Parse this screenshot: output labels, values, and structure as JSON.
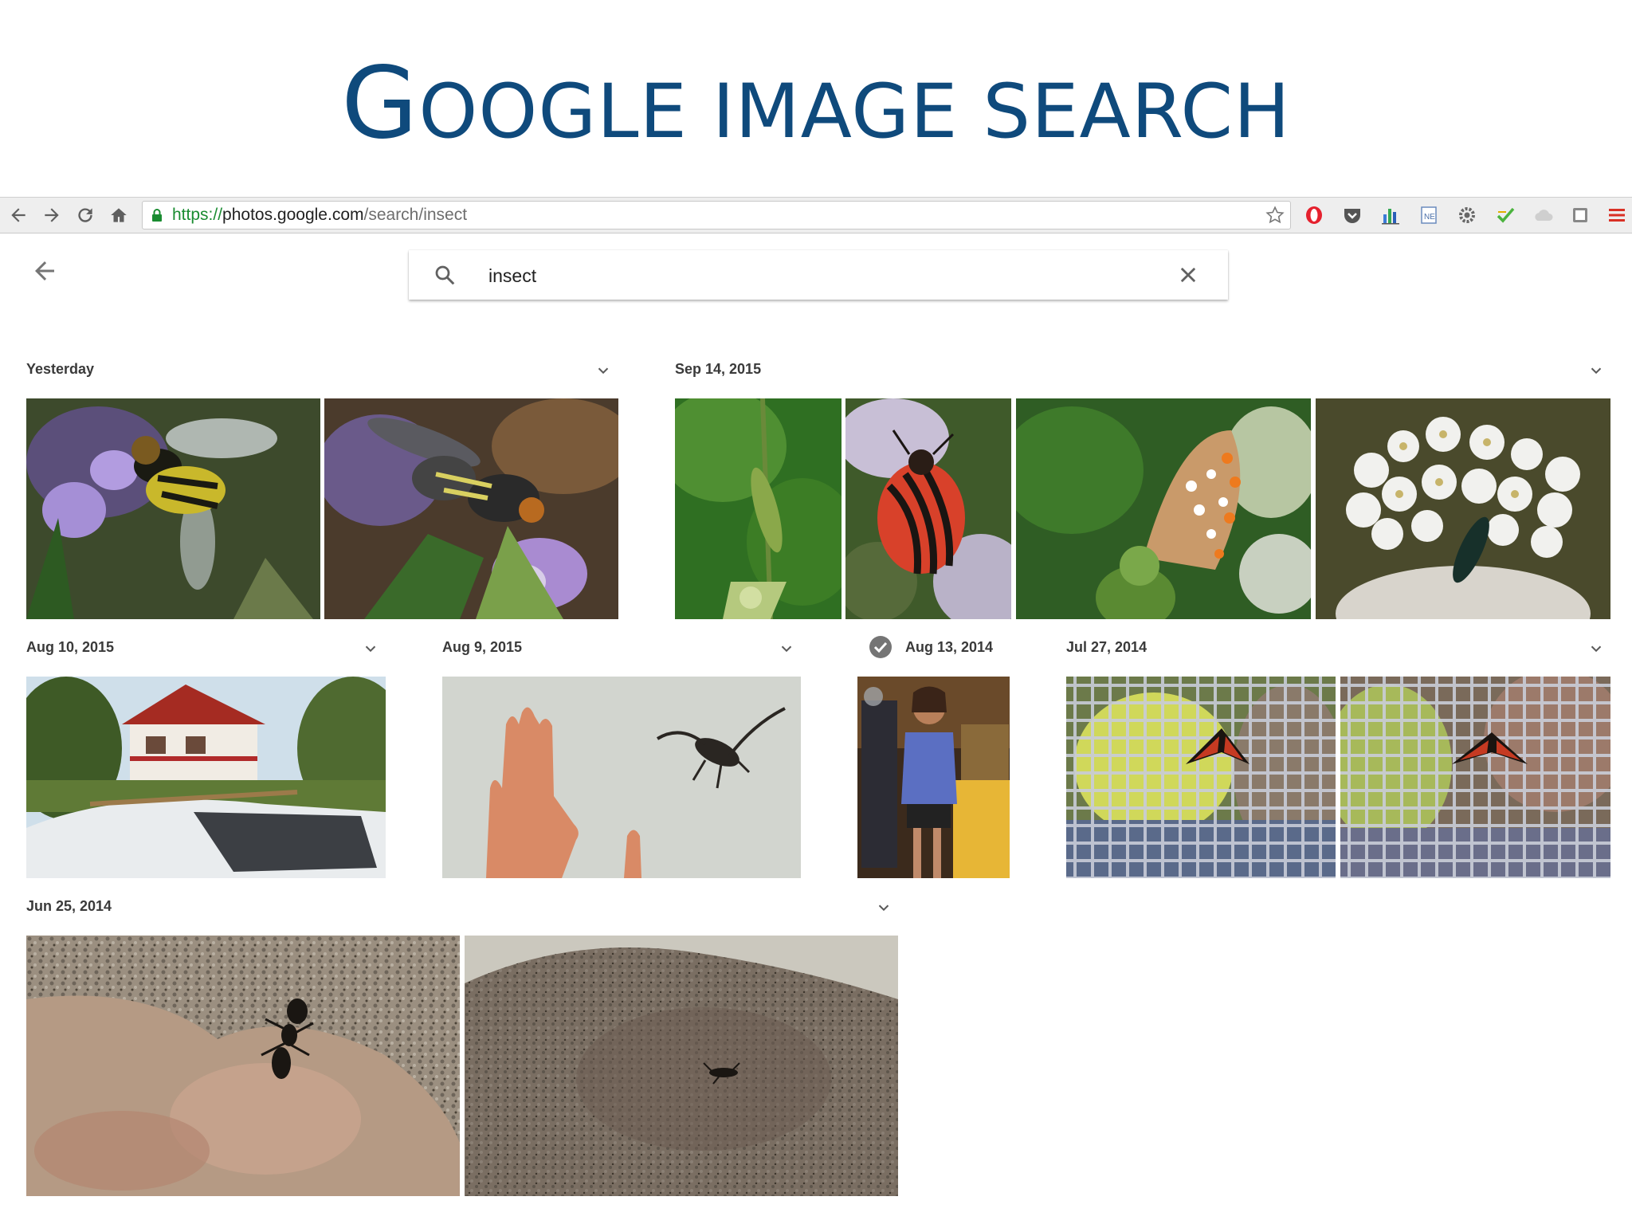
{
  "slide": {
    "title_first": "G",
    "title_rest": "OOGLE IMAGE SEARCH"
  },
  "browser": {
    "url_scheme": "https://",
    "url_host": "photos.google.com",
    "url_path": "/search/insect",
    "extensions": [
      "opera-icon",
      "pocket-icon",
      "chart-icon",
      "document-icon",
      "gear-icon",
      "checkmark-icon",
      "cloud-icon",
      "square-icon",
      "menu-icon"
    ]
  },
  "search": {
    "query": "insect"
  },
  "groups": [
    {
      "date": "Yesterday",
      "photos": [
        "hoverfly-on-lavender",
        "hoverfly-on-flower"
      ]
    },
    {
      "date": "Sep 14, 2015",
      "photos": [
        "green-beetle",
        "striped-shield-bug",
        "blue-butterfly",
        "beetle-on-white-flowers"
      ]
    },
    {
      "date": "Aug 10, 2015",
      "photos": [
        "house-and-car"
      ]
    },
    {
      "date": "Aug 9, 2015",
      "photos": [
        "hand-and-longhorn-beetle"
      ]
    },
    {
      "date": "Aug 13, 2014",
      "photos": [
        "girl-at-bar"
      ]
    },
    {
      "date": "Jul 27, 2014",
      "photos": [
        "moth-on-net-1",
        "moth-on-net-2"
      ]
    },
    {
      "date": "Jun 25, 2014",
      "photos": [
        "ant-on-rock-1",
        "ant-on-rock-2"
      ]
    }
  ],
  "colors": {
    "title": "#0f4a7c",
    "url_scheme": "#1a8c31"
  }
}
